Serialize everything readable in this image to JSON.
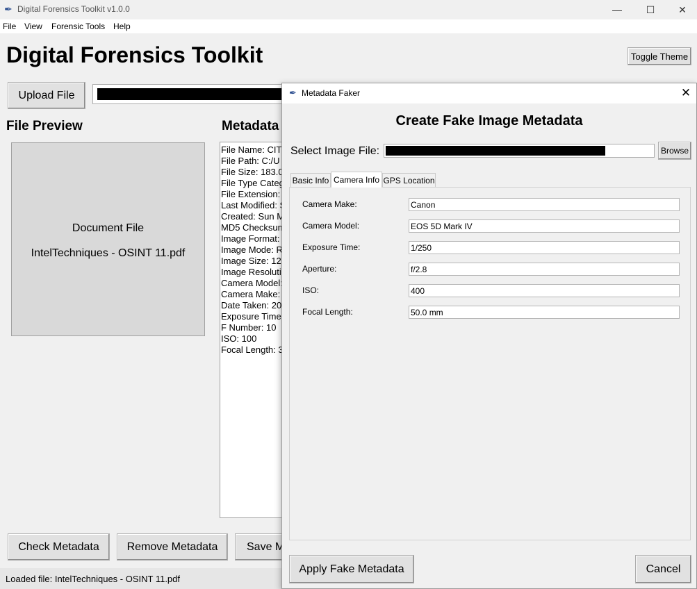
{
  "window": {
    "title": "Digital Forensics Toolkit v1.0.0",
    "controls": {
      "minimize": "—",
      "maximize": "☐",
      "close": "✕"
    }
  },
  "menu": [
    "File",
    "View",
    "Forensic Tools",
    "Help"
  ],
  "main": {
    "title": "Digital Forensics Toolkit",
    "toggle_theme": "Toggle Theme",
    "upload_button": "Upload File",
    "file_preview_heading": "File Preview",
    "metadata_heading": "Metadata",
    "preview": {
      "line1": "Document File",
      "line2": "IntelTechniques - OSINT 11.pdf"
    },
    "metadata_lines": [
      "File Name: CIT",
      "File Path: C:/U",
      "File Size: 183.0",
      "File Type Categ",
      "File Extension:",
      "Last Modified: S",
      "Created: Sun M",
      "MD5 Checksum",
      "Image Format:",
      "Image Mode: R",
      "Image Size: 12",
      "Image Resoluti",
      "Camera Model:",
      "Camera Make:",
      "Date Taken: 20",
      "Exposure Time",
      "F Number: 10",
      "ISO: 100",
      "Focal Length: 3"
    ],
    "buttons": {
      "check": "Check Metadata",
      "remove": "Remove Metadata",
      "save": "Save M"
    },
    "status": "Loaded file: IntelTechniques - OSINT 11.pdf"
  },
  "dialog": {
    "title": "Metadata Faker",
    "close": "✕",
    "heading": "Create Fake Image Metadata",
    "select_label": "Select Image File:",
    "browse": "Browse",
    "tabs": [
      "Basic Info",
      "Camera Info",
      "GPS Location"
    ],
    "active_tab": "Camera Info",
    "fields": [
      {
        "label": "Camera Make:",
        "value": "Canon"
      },
      {
        "label": "Camera Model:",
        "value": "EOS 5D Mark IV"
      },
      {
        "label": "Exposure Time:",
        "value": "1/250"
      },
      {
        "label": "Aperture:",
        "value": "f/2.8"
      },
      {
        "label": "ISO:",
        "value": "400"
      },
      {
        "label": "Focal Length:",
        "value": "50.0 mm"
      }
    ],
    "apply": "Apply Fake Metadata",
    "cancel": "Cancel"
  },
  "icons": {
    "app": "feather-icon",
    "dialog": "feather-icon"
  }
}
